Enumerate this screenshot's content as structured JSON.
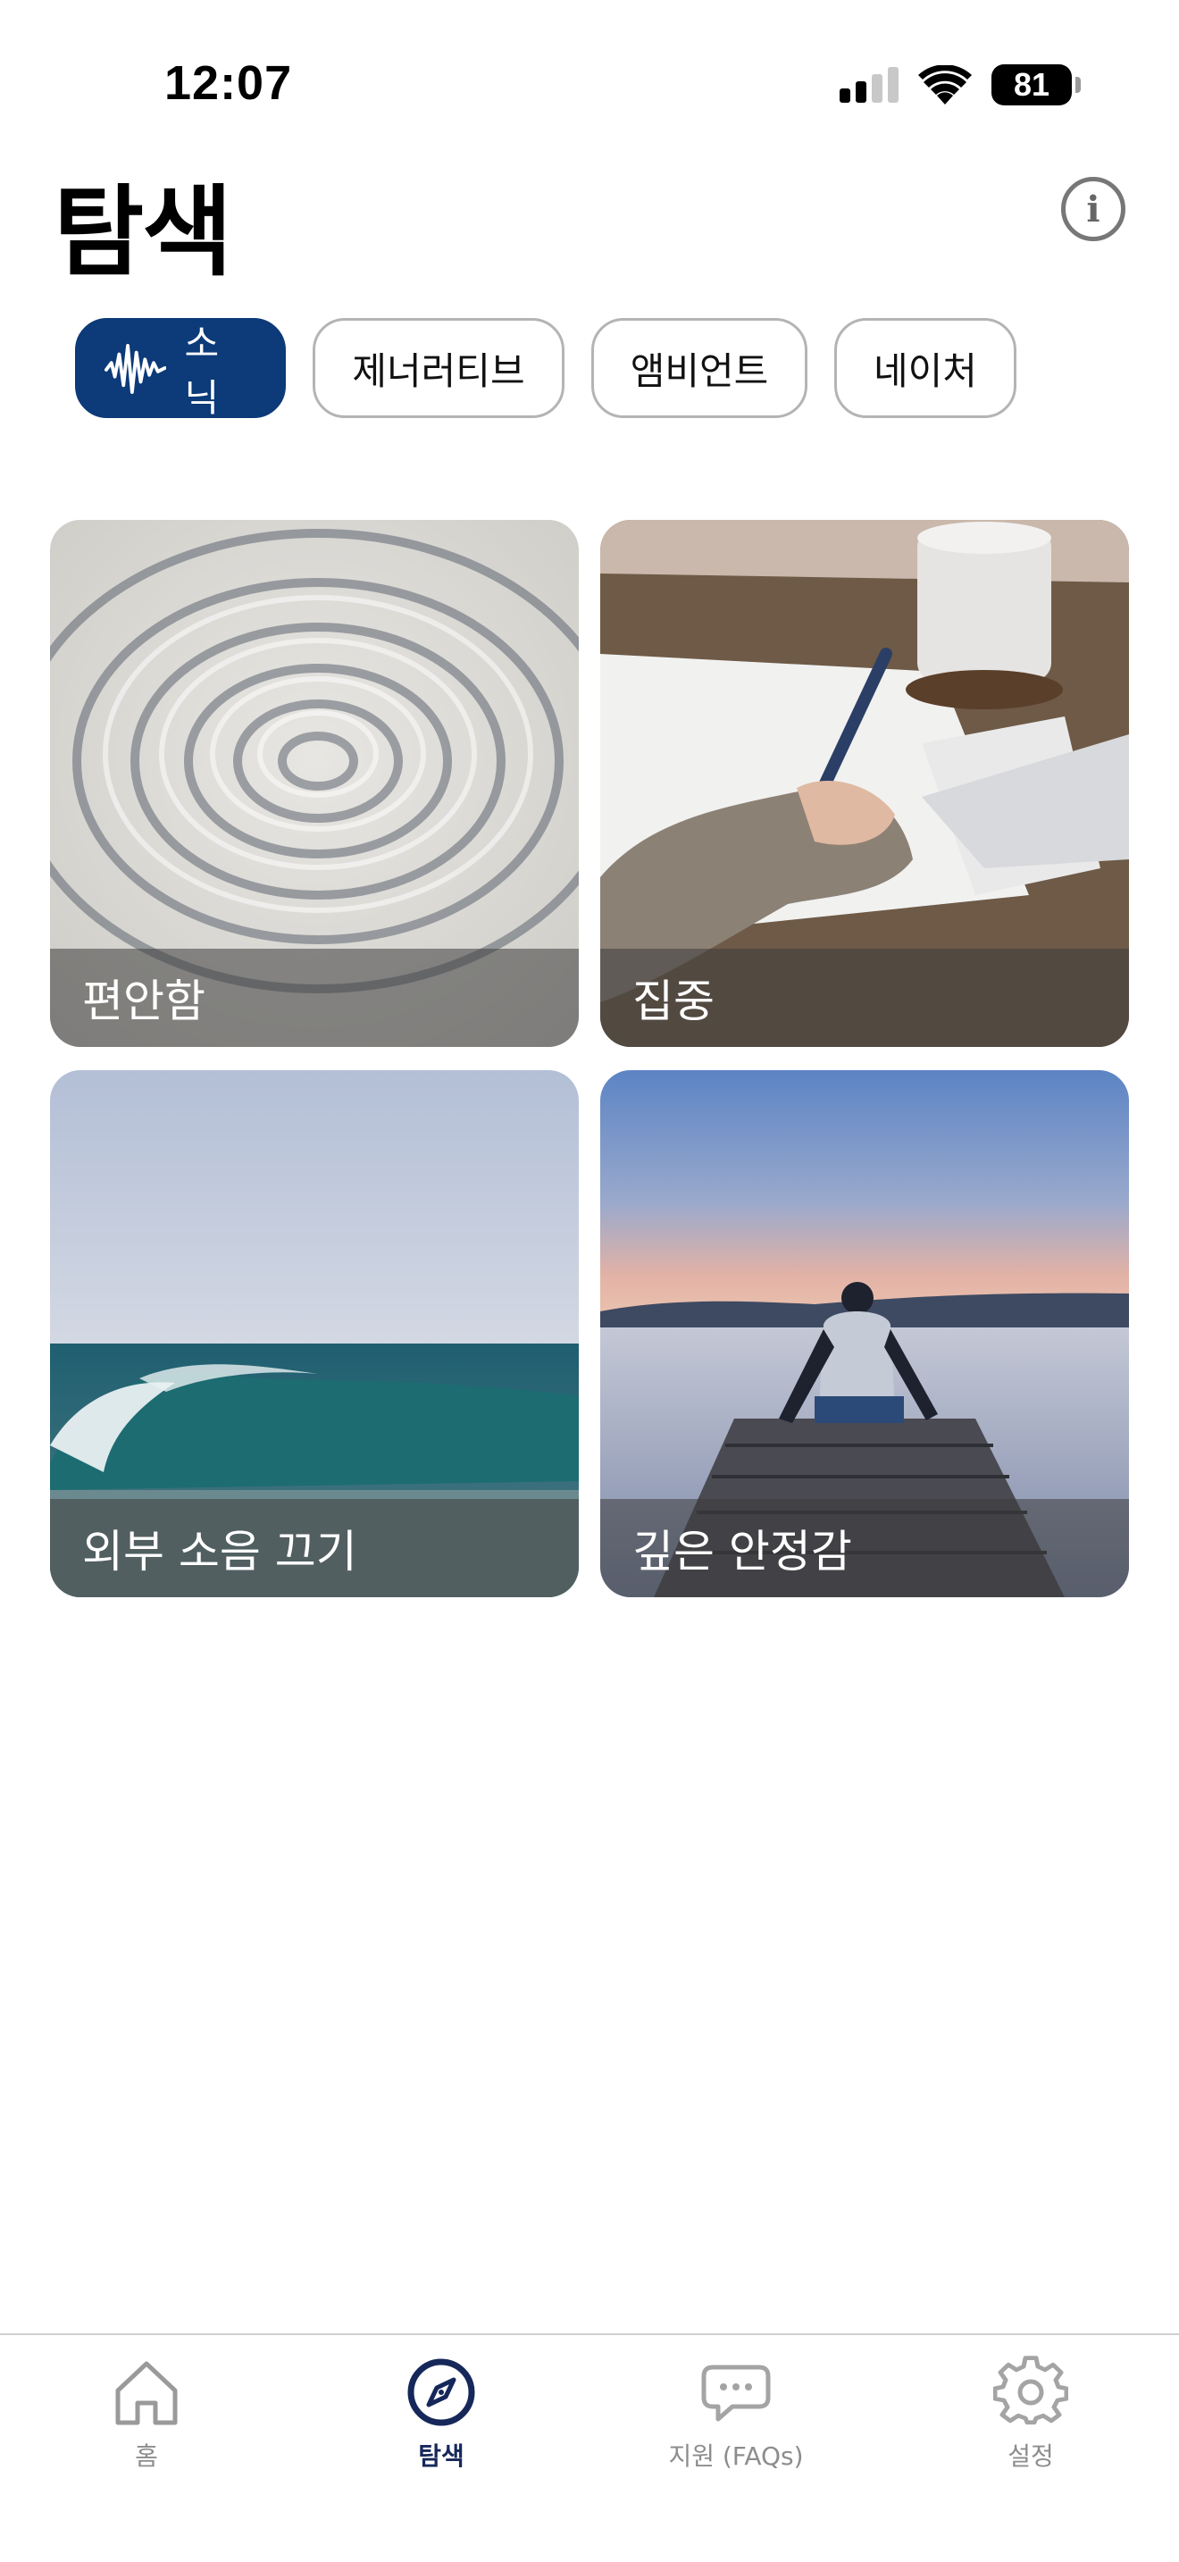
{
  "status_bar": {
    "time": "12:07",
    "battery": "81",
    "icons": [
      "signal-icon",
      "wifi-icon",
      "battery-icon"
    ]
  },
  "header": {
    "title": "탐색",
    "info_icon": "info-icon",
    "info_glyph": "i"
  },
  "filters": {
    "active_color": "#0d3a78",
    "chips": [
      {
        "label": "소닉",
        "icon": "waveform-icon",
        "selected": true
      },
      {
        "label": "제너러티브",
        "selected": false
      },
      {
        "label": "앰비언트",
        "selected": false
      },
      {
        "label": "네이처",
        "selected": false
      }
    ]
  },
  "cards": [
    {
      "label": "편안함",
      "image": "zen-sand-ripples"
    },
    {
      "label": "집중",
      "image": "hand-writing-at-desk"
    },
    {
      "label": "외부 소음 끄기",
      "image": "ocean-wave"
    },
    {
      "label": "깊은 안정감",
      "image": "man-on-pier-at-dusk"
    }
  ],
  "tab_bar": {
    "active_color": "#16285a",
    "tabs": [
      {
        "label": "홈",
        "icon": "home-icon",
        "active": false
      },
      {
        "label": "탐색",
        "icon": "compass-icon",
        "active": true
      },
      {
        "label": "지원 (FAQs)",
        "icon": "chat-bubble-icon",
        "active": false
      },
      {
        "label": "설정",
        "icon": "gear-icon",
        "active": false
      }
    ]
  }
}
